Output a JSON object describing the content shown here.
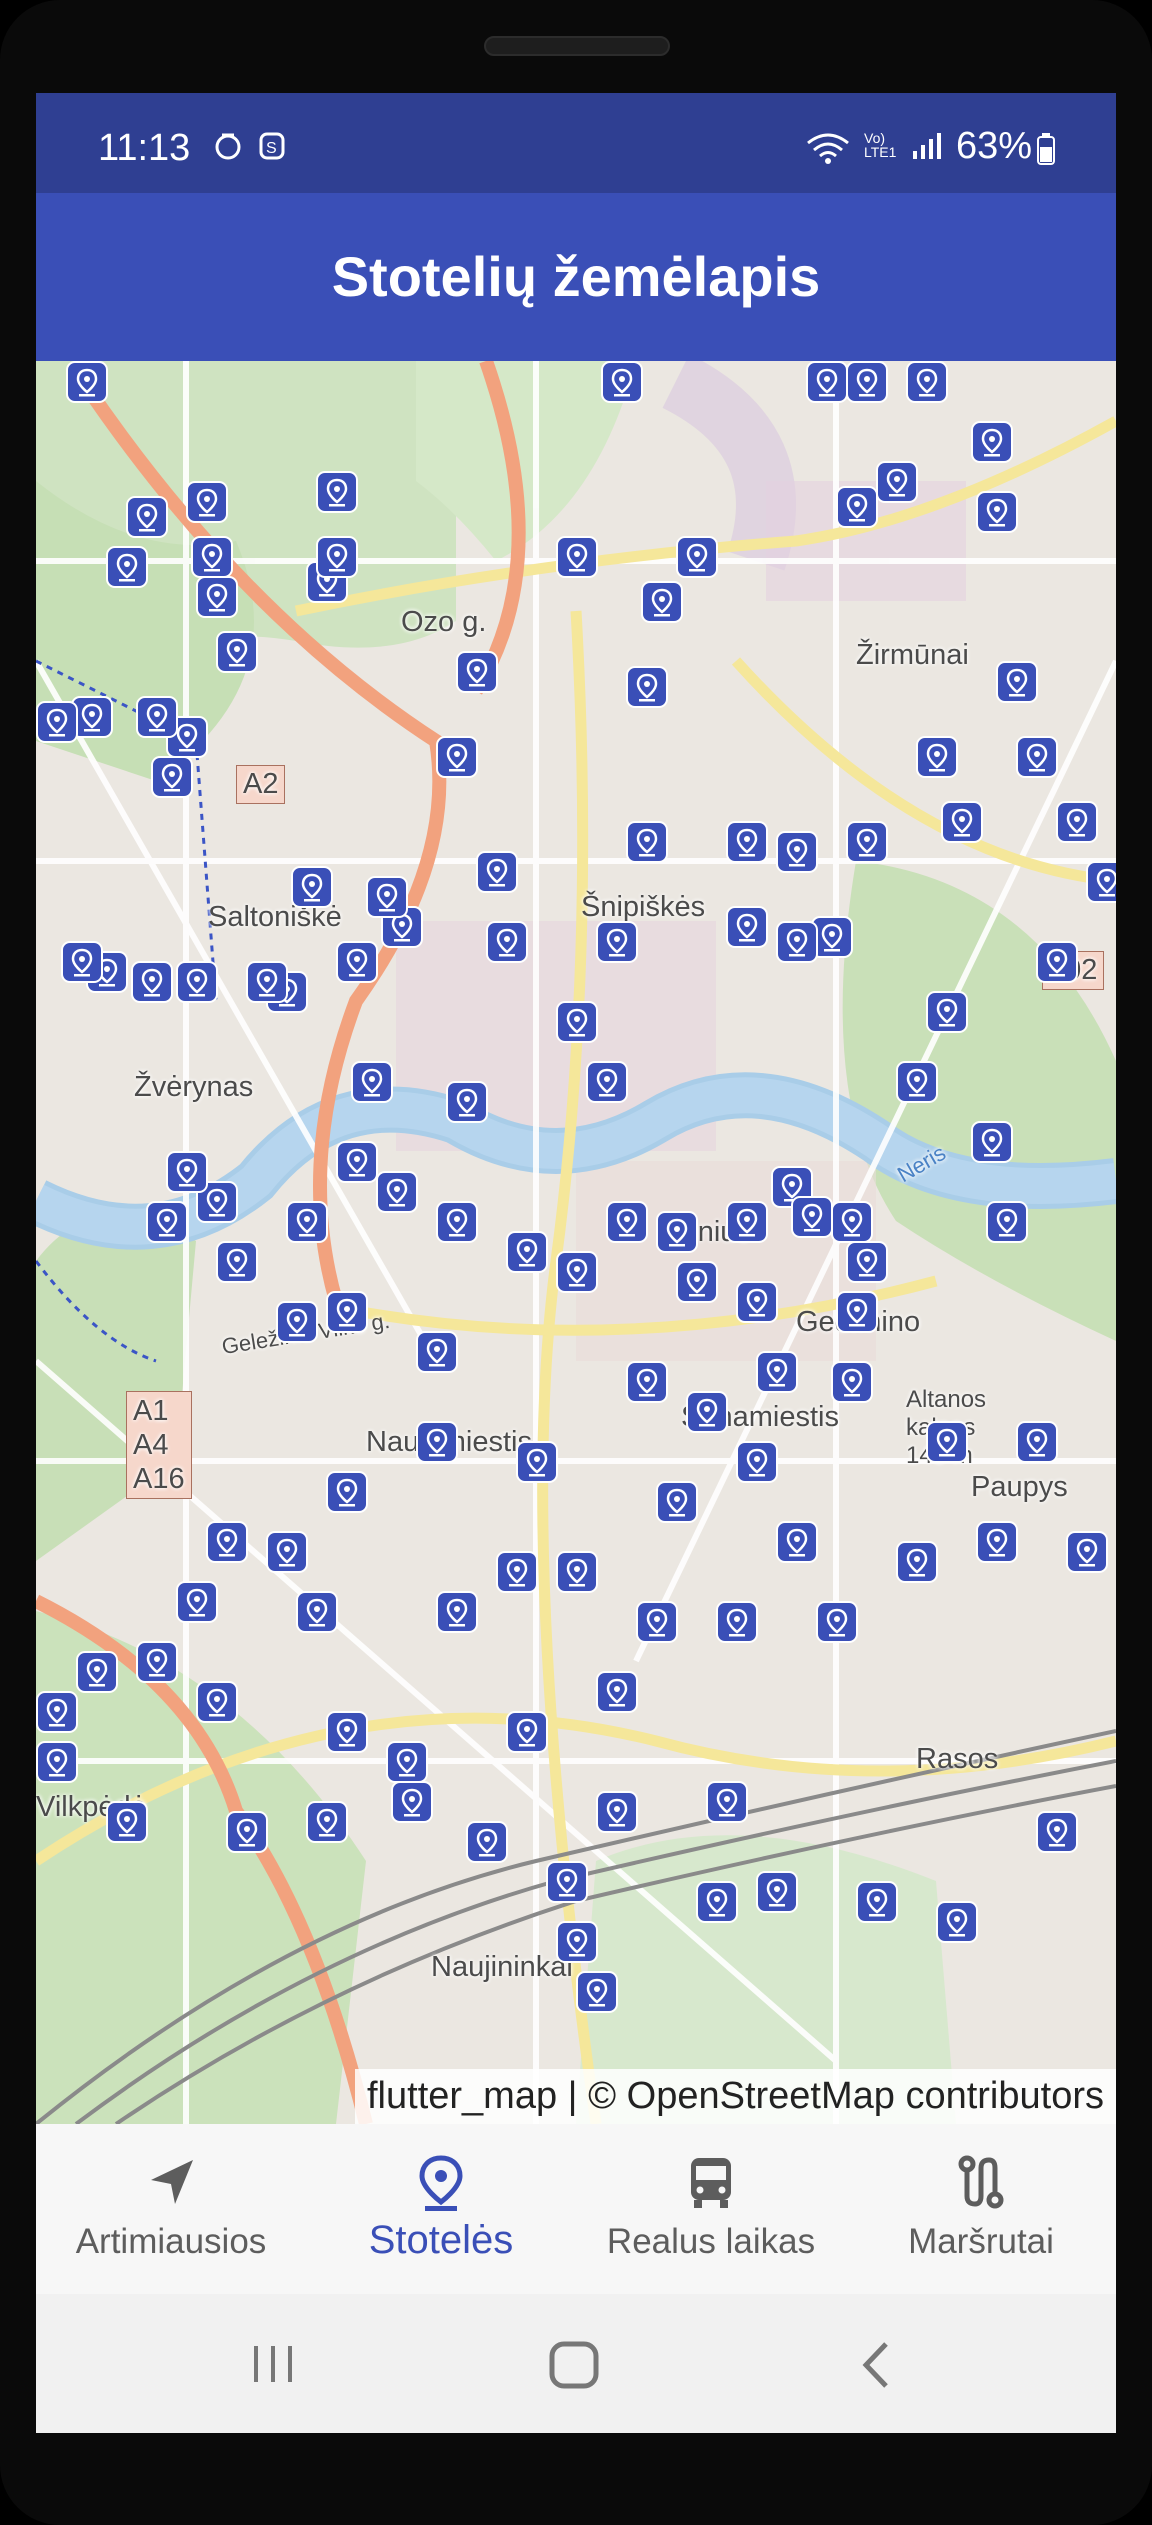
{
  "status_bar": {
    "time": "11:13",
    "network_label": "Vo)\nLTE1",
    "battery": "63%"
  },
  "app_bar": {
    "title": "Stotelių žemėlapis"
  },
  "map": {
    "labels": [
      {
        "text": "Ozo g."
      },
      {
        "text": "A2"
      },
      {
        "text": "Saltoniškė"
      },
      {
        "text": "Žirmūnai"
      },
      {
        "text": "Šnipiškės"
      },
      {
        "text": "102"
      },
      {
        "text": "Žvėrynas"
      },
      {
        "text": "Vilnius"
      },
      {
        "text": "Gedimino"
      },
      {
        "text": "Geležinio Vilko g."
      },
      {
        "text": "A1\nA4\nA16"
      },
      {
        "text": "Naujamiestis"
      },
      {
        "text": "Senamiestis"
      },
      {
        "text": "Altanos kalnas 145 m"
      },
      {
        "text": "Paupys"
      },
      {
        "text": "Vilkpėdė"
      },
      {
        "text": "Naujininkai"
      },
      {
        "text": "Rasos"
      },
      {
        "text": "Neris"
      }
    ],
    "attribution": "flutter_map | © OpenStreetMap contributors"
  },
  "bottom_nav": [
    {
      "label": "Artimiausios",
      "icon": "navigation-arrow-icon",
      "active": false
    },
    {
      "label": "Stotelės",
      "icon": "location-pin-icon",
      "active": true
    },
    {
      "label": "Realus laikas",
      "icon": "bus-icon",
      "active": false
    },
    {
      "label": "Maršrutai",
      "icon": "route-icon",
      "active": false
    }
  ],
  "colors": {
    "primary": "#3a4fb7",
    "status_bar": "#2f3f92"
  }
}
